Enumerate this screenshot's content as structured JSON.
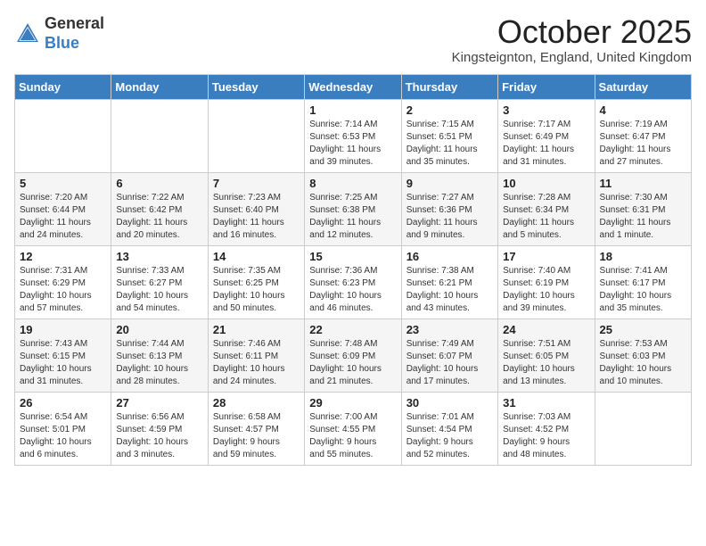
{
  "header": {
    "logo_line1": "General",
    "logo_line2": "Blue",
    "month_title": "October 2025",
    "location": "Kingsteignton, England, United Kingdom"
  },
  "weekdays": [
    "Sunday",
    "Monday",
    "Tuesday",
    "Wednesday",
    "Thursday",
    "Friday",
    "Saturday"
  ],
  "rows": [
    {
      "cells": [
        {
          "date": "",
          "info": ""
        },
        {
          "date": "",
          "info": ""
        },
        {
          "date": "",
          "info": ""
        },
        {
          "date": "1",
          "info": "Sunrise: 7:14 AM\nSunset: 6:53 PM\nDaylight: 11 hours\nand 39 minutes."
        },
        {
          "date": "2",
          "info": "Sunrise: 7:15 AM\nSunset: 6:51 PM\nDaylight: 11 hours\nand 35 minutes."
        },
        {
          "date": "3",
          "info": "Sunrise: 7:17 AM\nSunset: 6:49 PM\nDaylight: 11 hours\nand 31 minutes."
        },
        {
          "date": "4",
          "info": "Sunrise: 7:19 AM\nSunset: 6:47 PM\nDaylight: 11 hours\nand 27 minutes."
        }
      ]
    },
    {
      "cells": [
        {
          "date": "5",
          "info": "Sunrise: 7:20 AM\nSunset: 6:44 PM\nDaylight: 11 hours\nand 24 minutes."
        },
        {
          "date": "6",
          "info": "Sunrise: 7:22 AM\nSunset: 6:42 PM\nDaylight: 11 hours\nand 20 minutes."
        },
        {
          "date": "7",
          "info": "Sunrise: 7:23 AM\nSunset: 6:40 PM\nDaylight: 11 hours\nand 16 minutes."
        },
        {
          "date": "8",
          "info": "Sunrise: 7:25 AM\nSunset: 6:38 PM\nDaylight: 11 hours\nand 12 minutes."
        },
        {
          "date": "9",
          "info": "Sunrise: 7:27 AM\nSunset: 6:36 PM\nDaylight: 11 hours\nand 9 minutes."
        },
        {
          "date": "10",
          "info": "Sunrise: 7:28 AM\nSunset: 6:34 PM\nDaylight: 11 hours\nand 5 minutes."
        },
        {
          "date": "11",
          "info": "Sunrise: 7:30 AM\nSunset: 6:31 PM\nDaylight: 11 hours\nand 1 minute."
        }
      ]
    },
    {
      "cells": [
        {
          "date": "12",
          "info": "Sunrise: 7:31 AM\nSunset: 6:29 PM\nDaylight: 10 hours\nand 57 minutes."
        },
        {
          "date": "13",
          "info": "Sunrise: 7:33 AM\nSunset: 6:27 PM\nDaylight: 10 hours\nand 54 minutes."
        },
        {
          "date": "14",
          "info": "Sunrise: 7:35 AM\nSunset: 6:25 PM\nDaylight: 10 hours\nand 50 minutes."
        },
        {
          "date": "15",
          "info": "Sunrise: 7:36 AM\nSunset: 6:23 PM\nDaylight: 10 hours\nand 46 minutes."
        },
        {
          "date": "16",
          "info": "Sunrise: 7:38 AM\nSunset: 6:21 PM\nDaylight: 10 hours\nand 43 minutes."
        },
        {
          "date": "17",
          "info": "Sunrise: 7:40 AM\nSunset: 6:19 PM\nDaylight: 10 hours\nand 39 minutes."
        },
        {
          "date": "18",
          "info": "Sunrise: 7:41 AM\nSunset: 6:17 PM\nDaylight: 10 hours\nand 35 minutes."
        }
      ]
    },
    {
      "cells": [
        {
          "date": "19",
          "info": "Sunrise: 7:43 AM\nSunset: 6:15 PM\nDaylight: 10 hours\nand 31 minutes."
        },
        {
          "date": "20",
          "info": "Sunrise: 7:44 AM\nSunset: 6:13 PM\nDaylight: 10 hours\nand 28 minutes."
        },
        {
          "date": "21",
          "info": "Sunrise: 7:46 AM\nSunset: 6:11 PM\nDaylight: 10 hours\nand 24 minutes."
        },
        {
          "date": "22",
          "info": "Sunrise: 7:48 AM\nSunset: 6:09 PM\nDaylight: 10 hours\nand 21 minutes."
        },
        {
          "date": "23",
          "info": "Sunrise: 7:49 AM\nSunset: 6:07 PM\nDaylight: 10 hours\nand 17 minutes."
        },
        {
          "date": "24",
          "info": "Sunrise: 7:51 AM\nSunset: 6:05 PM\nDaylight: 10 hours\nand 13 minutes."
        },
        {
          "date": "25",
          "info": "Sunrise: 7:53 AM\nSunset: 6:03 PM\nDaylight: 10 hours\nand 10 minutes."
        }
      ]
    },
    {
      "cells": [
        {
          "date": "26",
          "info": "Sunrise: 6:54 AM\nSunset: 5:01 PM\nDaylight: 10 hours\nand 6 minutes."
        },
        {
          "date": "27",
          "info": "Sunrise: 6:56 AM\nSunset: 4:59 PM\nDaylight: 10 hours\nand 3 minutes."
        },
        {
          "date": "28",
          "info": "Sunrise: 6:58 AM\nSunset: 4:57 PM\nDaylight: 9 hours\nand 59 minutes."
        },
        {
          "date": "29",
          "info": "Sunrise: 7:00 AM\nSunset: 4:55 PM\nDaylight: 9 hours\nand 55 minutes."
        },
        {
          "date": "30",
          "info": "Sunrise: 7:01 AM\nSunset: 4:54 PM\nDaylight: 9 hours\nand 52 minutes."
        },
        {
          "date": "31",
          "info": "Sunrise: 7:03 AM\nSunset: 4:52 PM\nDaylight: 9 hours\nand 48 minutes."
        },
        {
          "date": "",
          "info": ""
        }
      ]
    }
  ]
}
